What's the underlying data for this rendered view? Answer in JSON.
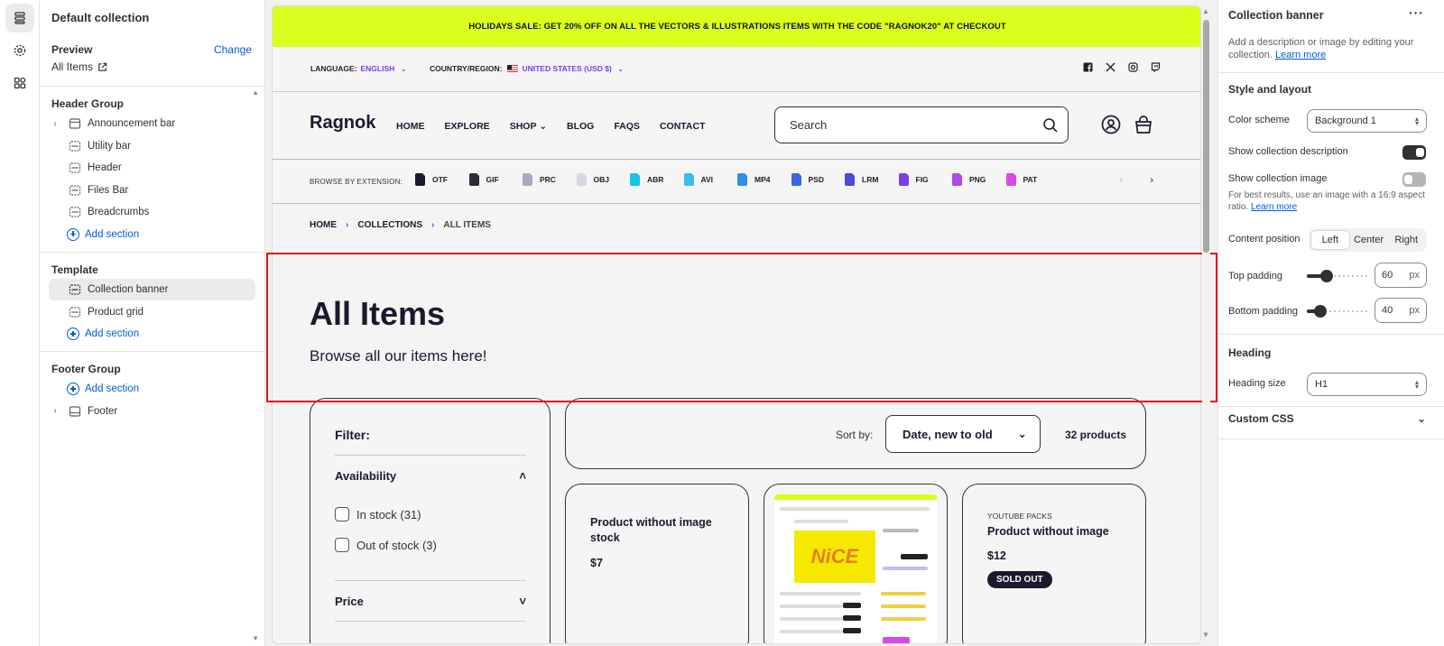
{
  "left_panel": {
    "title": "Default collection",
    "preview_label": "Preview",
    "change_label": "Change",
    "preview_value": "All Items",
    "header_group": {
      "title": "Header Group",
      "items": [
        "Announcement bar",
        "Utility bar",
        "Header",
        "Files Bar",
        "Breadcrumbs"
      ],
      "add_label": "Add section"
    },
    "template_group": {
      "title": "Template",
      "items": [
        "Collection banner",
        "Product grid"
      ],
      "add_label": "Add section"
    },
    "footer_group": {
      "title": "Footer Group",
      "add_label": "Add section",
      "items": [
        "Footer"
      ]
    }
  },
  "store": {
    "announcement": "HOLIDAYS SALE: GET 20% OFF ON ALL THE VECTORS & ILLUSTRATIONS ITEMS WITH THE CODE \"RAGNOK20\" AT CHECKOUT",
    "language_label": "LANGUAGE:",
    "language_value": "ENGLISH",
    "country_label": "COUNTRY/REGION:",
    "country_value": "UNITED STATES (USD $)",
    "logo": "Ragnok",
    "nav": [
      "HOME",
      "EXPLORE",
      "SHOP",
      "BLOG",
      "FAQS",
      "CONTACT"
    ],
    "search_placeholder": "Search",
    "browse_label": "BROWSE BY EXTENSION:",
    "extensions": [
      {
        "label": "OTF",
        "color": "#1a1a2e"
      },
      {
        "label": "GIF",
        "color": "#2d2d3a"
      },
      {
        "label": "PRC",
        "color": "#a9a9c2"
      },
      {
        "label": "OBJ",
        "color": "#d8d8e4"
      },
      {
        "label": "ABR",
        "color": "#19c3e6"
      },
      {
        "label": "AVI",
        "color": "#3bbcf0"
      },
      {
        "label": "MP4",
        "color": "#2f8cf0"
      },
      {
        "label": "PSD",
        "color": "#3d63e8"
      },
      {
        "label": "LRM",
        "color": "#4a4ad9"
      },
      {
        "label": "FIG",
        "color": "#7b3ee8"
      },
      {
        "label": "PNG",
        "color": "#b14ae8"
      },
      {
        "label": "PAT",
        "color": "#d84ae8"
      }
    ],
    "breadcrumbs": [
      "HOME",
      "COLLECTIONS",
      "ALL ITEMS"
    ],
    "banner_title": "All Items",
    "banner_desc": "Browse all our items here!",
    "filter": {
      "title": "Filter:",
      "availability": "Availability",
      "options": [
        "In stock (31)",
        "Out of stock (3)"
      ],
      "price": "Price"
    },
    "sort_label": "Sort by:",
    "sort_value": "Date, new to old",
    "count": "32 products",
    "cards": [
      {
        "title": "Product without image stock",
        "price": "$7"
      },
      {
        "title": "",
        "price": ""
      },
      {
        "vendor": "YOUTUBE PACKS",
        "title": "Product without image",
        "price": "$12",
        "badge": "SOLD OUT"
      }
    ],
    "accent": "#dbff1e",
    "purple": "#7b3ee8"
  },
  "right_panel": {
    "title": "Collection banner",
    "desc": "Add a description or image by editing your collection.",
    "learn_more": "Learn more",
    "style_title": "Style and layout",
    "color_scheme_label": "Color scheme",
    "color_scheme_value": "Background 1",
    "show_desc_label": "Show collection description",
    "show_desc_on": true,
    "show_image_label": "Show collection image",
    "show_image_on": false,
    "image_note": "For best results, use an image with a 16:9 aspect ratio.",
    "image_note_link": "Learn more",
    "content_position_label": "Content position",
    "positions": [
      "Left",
      "Center",
      "Right"
    ],
    "position_selected": "Left",
    "top_padding_label": "Top padding",
    "top_padding": "60",
    "top_padding_level": 0.6,
    "bottom_padding_label": "Bottom padding",
    "bottom_padding": "40",
    "bottom_padding_level": 0.4,
    "unit": "px",
    "heading_title": "Heading",
    "heading_size_label": "Heading size",
    "heading_size_value": "H1",
    "custom_css": "Custom CSS"
  }
}
